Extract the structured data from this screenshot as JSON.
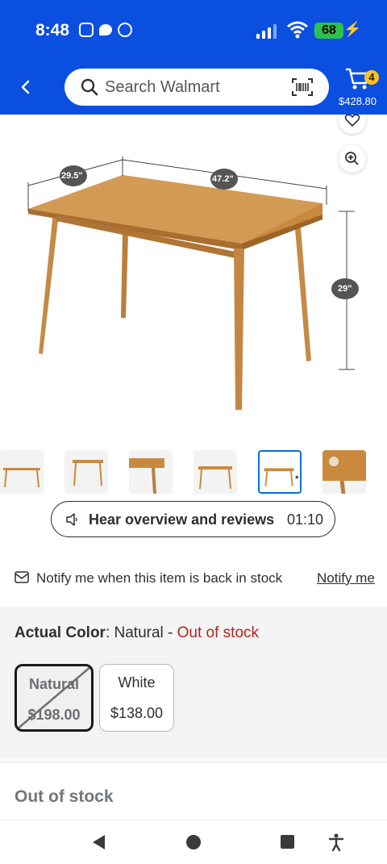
{
  "status_bar": {
    "time": "8:48",
    "battery": "68",
    "icons": [
      "instagram-icon",
      "chat-icon",
      "chrome-icon",
      "signal-icon",
      "wifi-icon",
      "battery-icon"
    ]
  },
  "header": {
    "search_placeholder": "Search Walmart",
    "cart_count": "4",
    "cart_total": "$428.80"
  },
  "product_image": {
    "dimensions": [
      "29.5\"",
      "47.2\"",
      "29\""
    ],
    "thumbnail_count": 6,
    "selected_thumbnail": 5
  },
  "overview": {
    "label": "Hear overview and reviews",
    "duration": "01:10"
  },
  "notify": {
    "text": "Notify me when this item is back in stock",
    "link": "Notify me"
  },
  "variants": {
    "heading_label": "Actual Color",
    "heading_value": ": Natural - ",
    "heading_status": "Out of stock",
    "options": [
      {
        "name": "Natural",
        "price": "$198.00",
        "selected": true,
        "unavailable": true
      },
      {
        "name": "White",
        "price": "$138.00",
        "selected": false,
        "unavailable": false
      }
    ]
  },
  "availability": {
    "title": "Out of stock"
  },
  "colors": {
    "brand_blue": "#0b4fe0",
    "cart_badge": "#ffc220",
    "out_of_stock_red": "#b3261e",
    "table_wood": "#c98a3f"
  }
}
